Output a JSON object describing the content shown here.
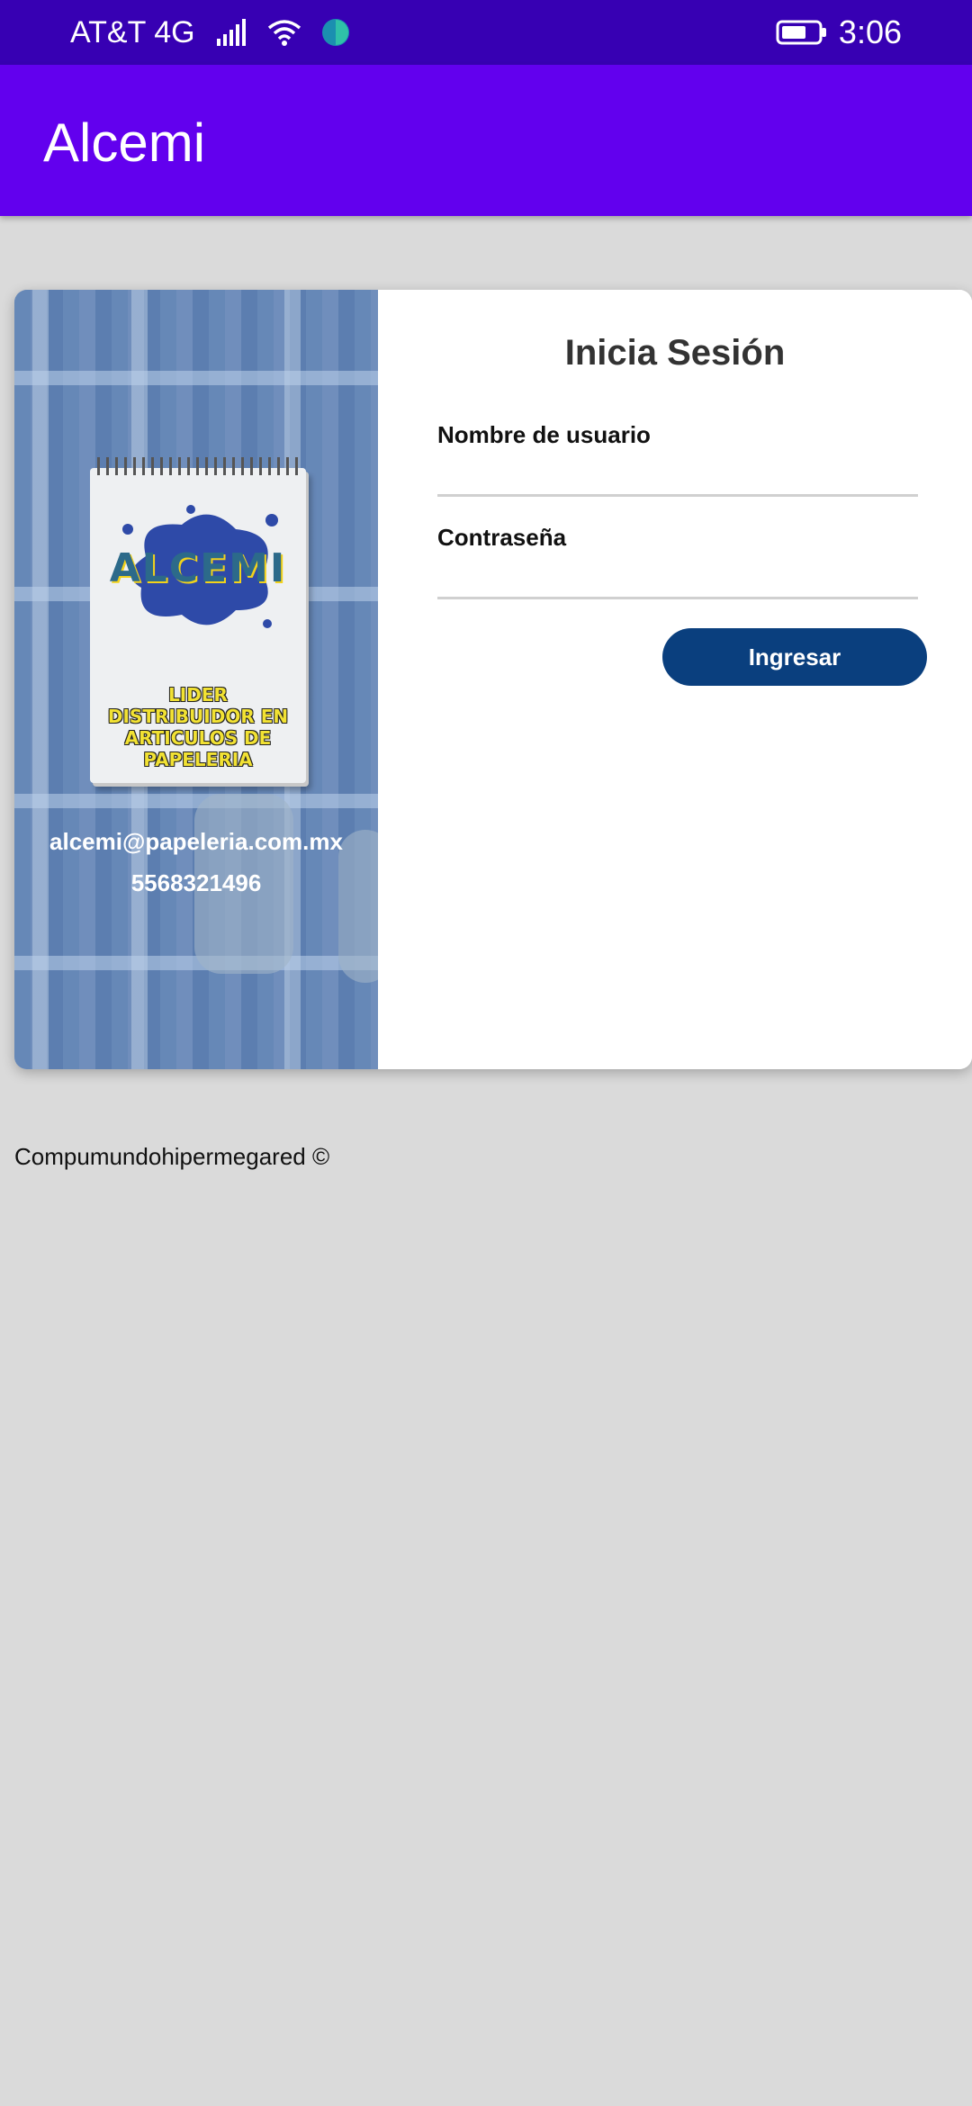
{
  "status_bar": {
    "carrier": "AT&T 4G",
    "time": "3:06"
  },
  "app_bar": {
    "title": "Alcemi"
  },
  "contact": {
    "email": "alcemi@papeleria.com.mx",
    "phone": "5568321496"
  },
  "logo": {
    "word": "ALCEMI",
    "slogan_line1": "LIDER DISTRIBUIDOR EN",
    "slogan_line2": "ARTICULOS DE PAPELERIA"
  },
  "login_form": {
    "title": "Inicia Sesión",
    "username_label": "Nombre de usuario",
    "username_value": "",
    "password_label": "Contraseña",
    "password_value": "",
    "submit_label": "Ingresar"
  },
  "footer": {
    "text": "Compumundohipermegared ©"
  },
  "colors": {
    "status_bar": "#3700b3",
    "app_bar": "#6200ee",
    "button": "#0a3f7e",
    "background": "#dadada"
  }
}
